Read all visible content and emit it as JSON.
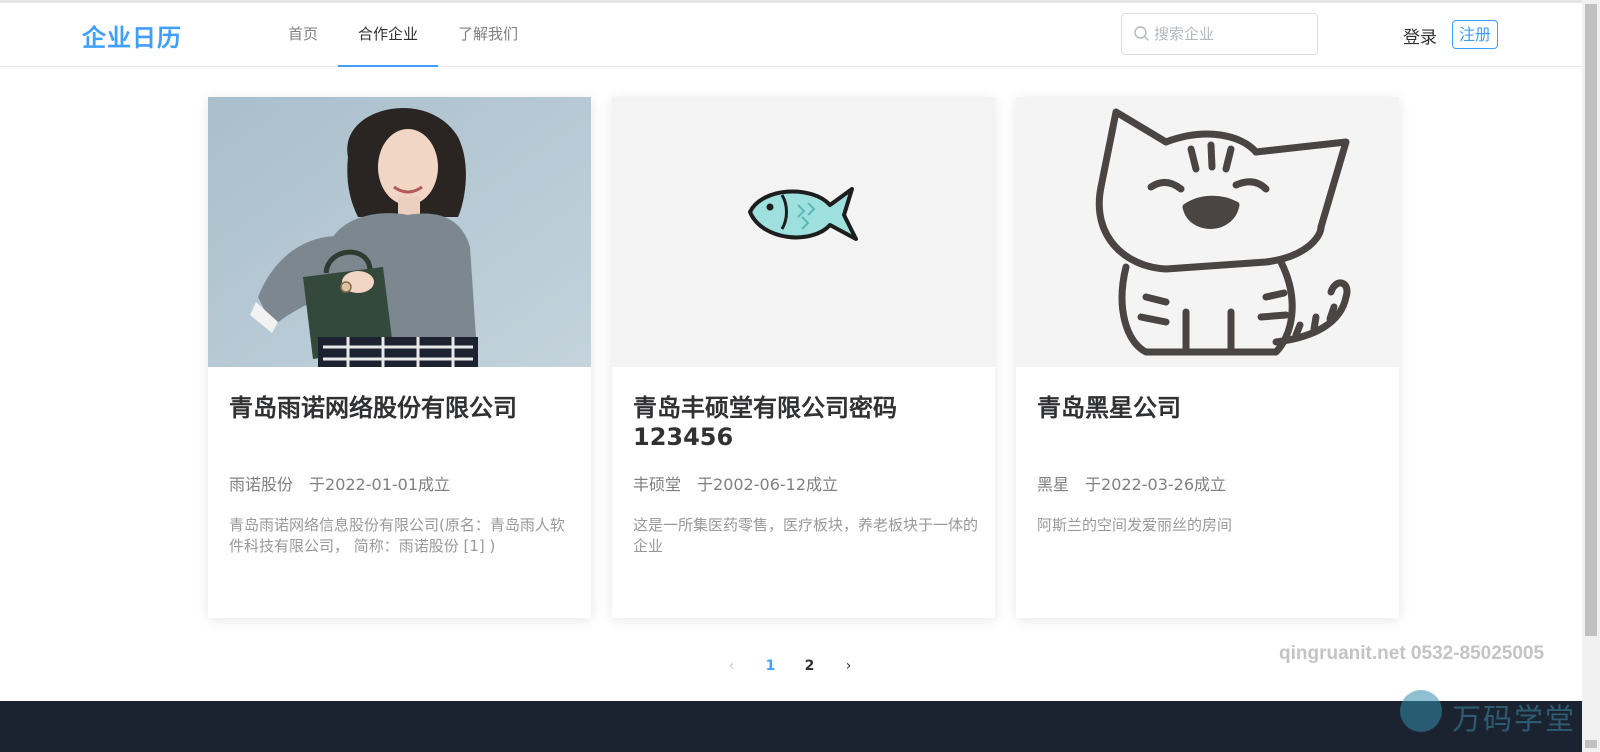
{
  "header": {
    "logo": "企业日历",
    "nav": [
      {
        "label": "首页",
        "active": false
      },
      {
        "label": "合作企业",
        "active": true
      },
      {
        "label": "了解我们",
        "active": false
      }
    ],
    "search": {
      "placeholder": "搜索企业",
      "value": ""
    },
    "login_label": "登录",
    "register_label": "注册",
    "accent_color": "#409eff"
  },
  "cards": [
    {
      "image": "woman-with-handbag-photo",
      "title": "青岛雨诺网络股份有限公司",
      "short_name": "雨诺股份",
      "founded": "于2022-01-01成立",
      "description": "青岛雨诺网络信息股份有限公司(原名：青岛雨人软件科技有限公司， 简称：雨诺股份 [1] )"
    },
    {
      "image": "fish-drawing",
      "title": "青岛丰硕堂有限公司密码123456",
      "short_name": "丰硕堂",
      "founded": "于2002-06-12成立",
      "description": "这是一所集医药零售，医疗板块，养老板块于一体的企业"
    },
    {
      "image": "cat-drawing",
      "title": "青岛黑星公司",
      "short_name": "黑星",
      "founded": "于2022-03-26成立",
      "description": "阿斯兰的空间发爱丽丝的房间"
    }
  ],
  "pagination": {
    "prev": "‹",
    "next": "›",
    "pages": [
      "1",
      "2"
    ],
    "current": "1"
  },
  "watermark": {
    "text": "qingruanit.net 0532-85025005",
    "brand": "万码学堂"
  },
  "footer_color": "#1b2330"
}
